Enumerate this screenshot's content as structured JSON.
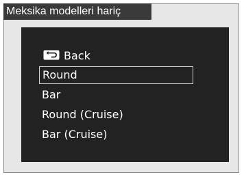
{
  "region_note": "Meksika modelleri hariç",
  "menu": {
    "back": {
      "icon": "back-arrow-icon",
      "label": "Back"
    },
    "items": [
      {
        "label": "Round",
        "selected": true
      },
      {
        "label": "Bar",
        "selected": false
      },
      {
        "label": "Round (Cruise)",
        "selected": false
      },
      {
        "label": "Bar (Cruise)",
        "selected": false
      }
    ]
  },
  "colors": {
    "screen_bg": "#222222",
    "frame_bg": "#e7e7e7",
    "tab_bg": "#3a3a3a",
    "text": "#ffffff",
    "selection_border": "#d7d7d7"
  }
}
